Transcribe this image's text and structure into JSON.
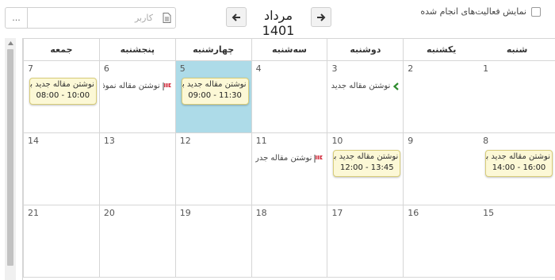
{
  "toolbar": {
    "show_done_label": "نمایش فعالیت‌های انجام شده",
    "show_done_checked": false,
    "month_title": "مرداد 1401",
    "user_placeholder": "کاربر",
    "more_label": "...",
    "prev_icon": "arrow-left-icon",
    "next_icon": "arrow-right-icon"
  },
  "calendar": {
    "weekdays": [
      "شنبه",
      "یکشنبه",
      "دوشنبه",
      "سه‌شنبه",
      "چهارشنبه",
      "پنجشنبه",
      "جمعه"
    ],
    "today_color": "#addbe8",
    "event_bg": "#fcf8d6",
    "weeks": [
      [
        {
          "day": "1"
        },
        {
          "day": "2"
        },
        {
          "day": "3",
          "line": {
            "text": "نوشتن مقاله جدید",
            "icon": "chevron-left-icon",
            "color": "#2e8b2e"
          }
        },
        {
          "day": "4"
        },
        {
          "day": "5",
          "today": true,
          "event": {
            "title": "نوشتن مقاله جدید بر",
            "time": "09:00  -  11:30"
          }
        },
        {
          "day": "6",
          "line": {
            "text": "نوشتن مقاله نموذ",
            "icon": "flag-icon",
            "color": "#cc2233"
          }
        },
        {
          "day": "7",
          "event": {
            "title": "نوشتن مقاله جدید بر",
            "time": "08:00  -  10:00"
          }
        }
      ],
      [
        {
          "day": "8",
          "event": {
            "title": "نوشتن مقاله جدید بر",
            "time": "14:00  -  16:00"
          }
        },
        {
          "day": "9"
        },
        {
          "day": "10",
          "event": {
            "title": "نوشتن مقاله جدید بر",
            "time": "12:00  -  13:45"
          }
        },
        {
          "day": "11",
          "line": {
            "text": "نوشتن مقاله جدر",
            "icon": "flag-icon",
            "color": "#cc2233"
          }
        },
        {
          "day": "12"
        },
        {
          "day": "13"
        },
        {
          "day": "14"
        }
      ],
      [
        {
          "day": "15"
        },
        {
          "day": "16"
        },
        {
          "day": "17"
        },
        {
          "day": "18"
        },
        {
          "day": "19"
        },
        {
          "day": "20"
        },
        {
          "day": "21"
        }
      ]
    ]
  }
}
